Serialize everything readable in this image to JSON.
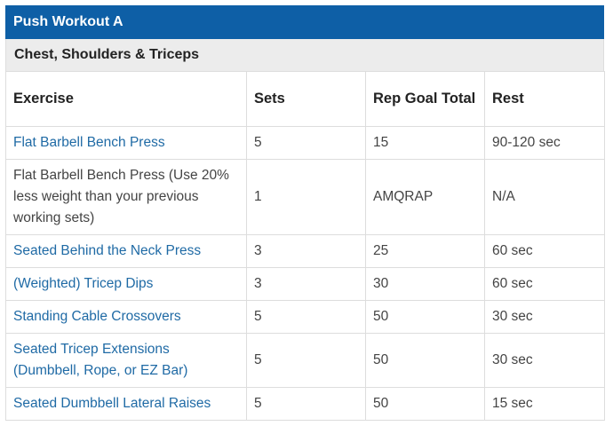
{
  "title": "Push Workout A",
  "subtitle": "Chest, Shoulders & Triceps",
  "headers": {
    "exercise": "Exercise",
    "sets": "Sets",
    "rep_goal": "Rep Goal Total",
    "rest": "Rest"
  },
  "rows": [
    {
      "exercise": "Flat Barbell Bench Press",
      "sets": "5",
      "reps": "15",
      "rest": "90-120 sec"
    },
    {
      "exercise": "Flat Barbell Bench Press (Use 20% less weight than your previous working sets)",
      "sets": "1",
      "reps": "AMQRAP",
      "rest": "N/A"
    },
    {
      "exercise": "Seated Behind the Neck Press",
      "sets": "3",
      "reps": "25",
      "rest": "60 sec"
    },
    {
      "exercise": "(Weighted) Tricep Dips",
      "sets": "3",
      "reps": "30",
      "rest": "60 sec"
    },
    {
      "exercise": "Standing Cable Crossovers",
      "sets": "5",
      "reps": "50",
      "rest": "30 sec"
    },
    {
      "exercise": "Seated Tricep Extensions (Dumbbell, Rope, or EZ Bar)",
      "sets": "5",
      "reps": "50",
      "rest": "30 sec"
    },
    {
      "exercise": "Seated Dumbbell Lateral Raises",
      "sets": "5",
      "reps": "50",
      "rest": "15 sec"
    }
  ],
  "colors": {
    "title_bg": "#0e5fa6",
    "subtitle_bg": "#ececec",
    "link_text": "#1f6aa5",
    "border": "#dddddd"
  }
}
